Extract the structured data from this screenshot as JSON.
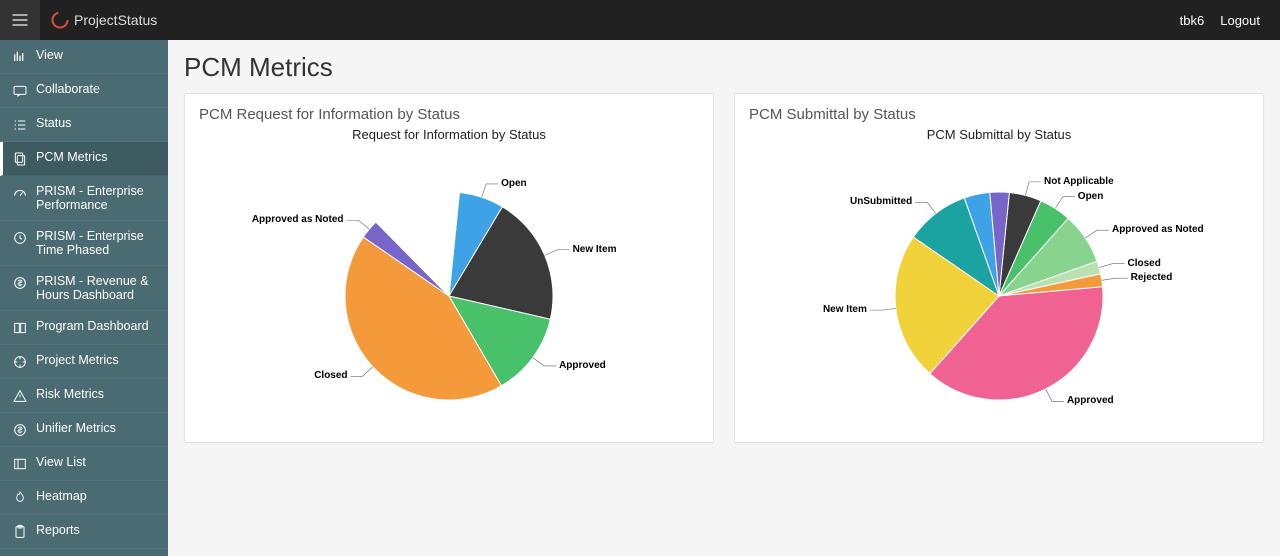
{
  "brand": "ProjectStatus",
  "user": "tbk6",
  "logout": "Logout",
  "pageTitle": "PCM Metrics",
  "sidebar": {
    "items": [
      {
        "label": "View",
        "icon": "bars-icon"
      },
      {
        "label": "Collaborate",
        "icon": "chat-icon"
      },
      {
        "label": "Status",
        "icon": "list-icon"
      },
      {
        "label": "PCM Metrics",
        "icon": "copy-icon",
        "active": true
      },
      {
        "label": "PRISM - Enterprise Performance",
        "icon": "gauge-icon"
      },
      {
        "label": "PRISM - Enterprise Time Phased",
        "icon": "clock-icon"
      },
      {
        "label": "PRISM - Revenue & Hours Dashboard",
        "icon": "dollar-icon"
      },
      {
        "label": "Program Dashboard",
        "icon": "book-icon"
      },
      {
        "label": "Project Metrics",
        "icon": "target-icon"
      },
      {
        "label": "Risk Metrics",
        "icon": "warning-icon"
      },
      {
        "label": "Unifier Metrics",
        "icon": "dollar-icon"
      },
      {
        "label": "View List",
        "icon": "panel-icon"
      },
      {
        "label": "Heatmap",
        "icon": "fire-icon"
      },
      {
        "label": "Reports",
        "icon": "clipboard-icon"
      }
    ]
  },
  "cards": [
    {
      "title": "PCM Request for Information by Status",
      "chartTitle": "Request for Information by Status"
    },
    {
      "title": "PCM Submittal by Status",
      "chartTitle": "PCM Submittal by Status"
    }
  ],
  "chart_data": [
    {
      "type": "pie",
      "title": "Request for Information by Status",
      "series": [
        {
          "name": "RFI",
          "values": [
            7,
            20,
            13,
            43,
            3,
            14
          ]
        }
      ],
      "categories": [
        "Open",
        "New Item",
        "Approved",
        "Closed",
        "Approved as Noted",
        "(blank)"
      ],
      "colors": [
        "#3ea3e6",
        "#3a3a3a",
        "#49c06a",
        "#f59a3b",
        "#7765c9",
        "#ffffff"
      ]
    },
    {
      "type": "pie",
      "title": "PCM Submittal by Status",
      "series": [
        {
          "name": "Submittal",
          "values": [
            5,
            5,
            8,
            2,
            2,
            38,
            23,
            10,
            4,
            3
          ]
        }
      ],
      "categories": [
        "Not Applicable",
        "Open",
        "Approved as Noted",
        "Closed",
        "Rejected",
        "Approved",
        "New Item",
        "UnSubmitted",
        "(blank1)",
        "(blank2)"
      ],
      "colors": [
        "#3a3a3a",
        "#49c06a",
        "#88d48f",
        "#b8e0b0",
        "#f59a3b",
        "#f06292",
        "#f2d23a",
        "#1aa3a0",
        "#3ea3e6",
        "#7765c9"
      ]
    }
  ]
}
